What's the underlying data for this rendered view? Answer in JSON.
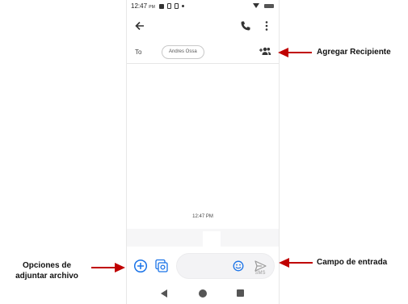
{
  "status_bar": {
    "time": "12:47",
    "ampm": "PM"
  },
  "recipients": {
    "to_label": "To",
    "chip": "Andres Ossa"
  },
  "conversation": {
    "timestamp": "12:47 PM"
  },
  "compose": {
    "send_label": "SMS"
  },
  "annotations": {
    "add_recipient": "Agregar Recipiente",
    "input_field": "Campo de entrada",
    "attach_options_line1": "Opciones de",
    "attach_options_line2": "adjuntar archivo"
  },
  "colors": {
    "accent_blue": "#1a73e8",
    "arrow_red": "#c00000",
    "icon_dark": "#333333"
  }
}
